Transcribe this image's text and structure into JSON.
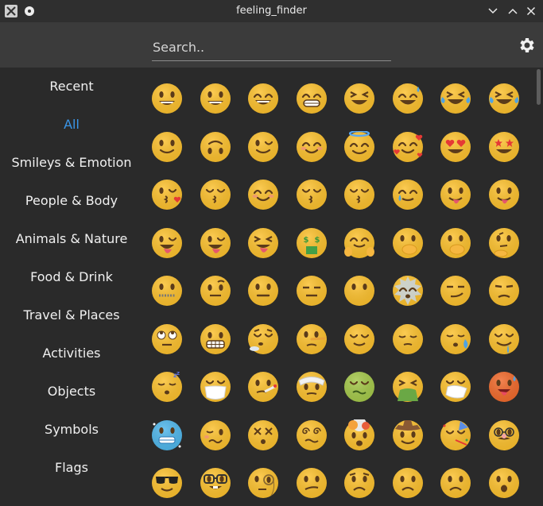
{
  "window": {
    "title": "feeling_finder"
  },
  "search": {
    "placeholder": "Search.."
  },
  "sidebar": {
    "items": [
      {
        "label": "Recent"
      },
      {
        "label": "All",
        "active": true
      },
      {
        "label": "Smileys & Emotion"
      },
      {
        "label": "People & Body"
      },
      {
        "label": "Animals & Nature"
      },
      {
        "label": "Food & Drink"
      },
      {
        "label": "Travel & Places"
      },
      {
        "label": "Activities"
      },
      {
        "label": "Objects"
      },
      {
        "label": "Symbols"
      },
      {
        "label": "Flags"
      }
    ]
  },
  "colors": {
    "accent": "#3a96e8",
    "emoji_face": "#fbc02d",
    "emoji_face_light": "#fdd54a",
    "emoji_feature": "#5b3b1a"
  },
  "emojis": [
    {
      "name": "grinning-face",
      "kind": "grin"
    },
    {
      "name": "grinning-face-with-big-eyes",
      "kind": "grin"
    },
    {
      "name": "grinning-face-with-smiling-eyes",
      "kind": "grin-smile"
    },
    {
      "name": "beaming-face-with-smiling-eyes",
      "kind": "teeth"
    },
    {
      "name": "grinning-squinting-face",
      "kind": "squint"
    },
    {
      "name": "grinning-face-with-sweat",
      "kind": "sweat"
    },
    {
      "name": "rolling-on-the-floor-laughing",
      "kind": "tears"
    },
    {
      "name": "face-with-tears-of-joy",
      "kind": "tears"
    },
    {
      "name": "slightly-smiling-face",
      "kind": "smile"
    },
    {
      "name": "upside-down-face",
      "kind": "upside"
    },
    {
      "name": "winking-face",
      "kind": "wink"
    },
    {
      "name": "smiling-face-with-smiling-eyes",
      "kind": "blush"
    },
    {
      "name": "smiling-face-with-halo",
      "kind": "halo"
    },
    {
      "name": "smiling-face-with-hearts",
      "kind": "hearts"
    },
    {
      "name": "smiling-face-with-heart-eyes",
      "kind": "heart-eyes"
    },
    {
      "name": "star-struck",
      "kind": "star-eyes"
    },
    {
      "name": "face-blowing-a-kiss",
      "kind": "kiss-heart"
    },
    {
      "name": "kissing-face",
      "kind": "kiss"
    },
    {
      "name": "smiling-face",
      "kind": "blush"
    },
    {
      "name": "kissing-face-with-closed-eyes",
      "kind": "kiss"
    },
    {
      "name": "kissing-face-with-smiling-eyes",
      "kind": "kiss"
    },
    {
      "name": "smiling-face-with-tear",
      "kind": "smile-tear"
    },
    {
      "name": "face-savoring-food",
      "kind": "tongue"
    },
    {
      "name": "face-with-tongue",
      "kind": "tongue"
    },
    {
      "name": "winking-face-with-tongue",
      "kind": "tongue-wink"
    },
    {
      "name": "zany-face",
      "kind": "tongue-wink"
    },
    {
      "name": "squinting-face-with-tongue",
      "kind": "tongue-squint"
    },
    {
      "name": "money-mouth-face",
      "kind": "money"
    },
    {
      "name": "hugging-face",
      "kind": "hug"
    },
    {
      "name": "face-with-hand-over-mouth",
      "kind": "hand-mouth"
    },
    {
      "name": "shushing-face",
      "kind": "hand-mouth"
    },
    {
      "name": "thinking-face",
      "kind": "thinking"
    },
    {
      "name": "zipper-mouth-face",
      "kind": "zipper"
    },
    {
      "name": "face-with-raised-eyebrow",
      "kind": "eyebrow"
    },
    {
      "name": "neutral-face",
      "kind": "neutral"
    },
    {
      "name": "expressionless-face",
      "kind": "expressionless"
    },
    {
      "name": "face-without-mouth",
      "kind": "no-mouth"
    },
    {
      "name": "face-exhaling",
      "kind": "burst"
    },
    {
      "name": "smirking-face",
      "kind": "smirk"
    },
    {
      "name": "unamused-face",
      "kind": "unamused"
    },
    {
      "name": "face-with-rolling-eyes",
      "kind": "rolling-eyes"
    },
    {
      "name": "grimacing-face",
      "kind": "grimace"
    },
    {
      "name": "lying-face",
      "kind": "sigh"
    },
    {
      "name": "face-with-long-nose",
      "kind": "long-nose"
    },
    {
      "name": "relieved-face",
      "kind": "relieved"
    },
    {
      "name": "pensive-face",
      "kind": "pensive"
    },
    {
      "name": "sleepy-face",
      "kind": "sleepy"
    },
    {
      "name": "drooling-face",
      "kind": "drool"
    },
    {
      "name": "sleeping-face",
      "kind": "sleeping"
    },
    {
      "name": "face-with-medical-mask",
      "kind": "mask"
    },
    {
      "name": "face-with-thermometer",
      "kind": "thermometer"
    },
    {
      "name": "face-with-head-bandage",
      "kind": "bandage"
    },
    {
      "name": "nauseated-face",
      "kind": "green"
    },
    {
      "name": "face-vomiting",
      "kind": "vomit"
    },
    {
      "name": "sneezing-face",
      "kind": "sneeze"
    },
    {
      "name": "hot-face",
      "kind": "hot"
    },
    {
      "name": "cold-face",
      "kind": "cold"
    },
    {
      "name": "woozy-face",
      "kind": "woozy"
    },
    {
      "name": "knocked-out-face",
      "kind": "xeyes"
    },
    {
      "name": "face-with-spiral-eyes",
      "kind": "spiral"
    },
    {
      "name": "exploding-head",
      "kind": "explode"
    },
    {
      "name": "cowboy-hat-face",
      "kind": "cowboy"
    },
    {
      "name": "partying-face",
      "kind": "party"
    },
    {
      "name": "disguised-face",
      "kind": "disguise"
    },
    {
      "name": "smiling-face-with-sunglasses",
      "kind": "sunglasses"
    },
    {
      "name": "nerd-face",
      "kind": "nerd"
    },
    {
      "name": "face-with-monocle",
      "kind": "monocle"
    },
    {
      "name": "confused-face",
      "kind": "confused"
    },
    {
      "name": "worried-face",
      "kind": "worried"
    },
    {
      "name": "slightly-frowning-face",
      "kind": "frown"
    },
    {
      "name": "frowning-face",
      "kind": "frown"
    },
    {
      "name": "face-with-open-mouth",
      "kind": "open-mouth"
    }
  ]
}
